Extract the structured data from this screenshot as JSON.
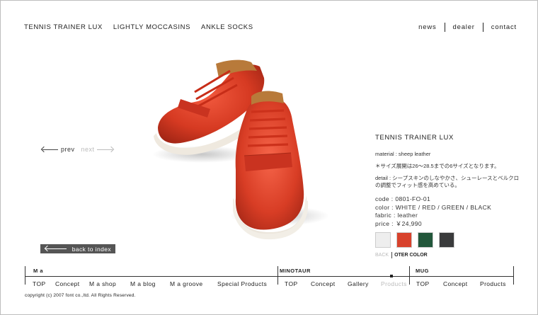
{
  "top_nav": {
    "items": [
      "TENNIS TRAINER LUX",
      "LIGHTLY MOCCASINS",
      "ANKLE SOCKS"
    ]
  },
  "right_nav": {
    "items": [
      "news",
      "dealer",
      "contact"
    ]
  },
  "pager": {
    "prev": "prev",
    "next": "next"
  },
  "back_to_index": "back to index",
  "product": {
    "title": "TENNIS TRAINER LUX",
    "material": "material : sheep leather",
    "size_note": "＊サイズ展開は26〜28.5までの6サイズとなります。",
    "detail": "detail : シープスキンのしなやかさ、シューレースとベルクロの調整でフィット感を高めている。",
    "code": "code : 0801-FO-01",
    "color": "color : WHITE / RED / GREEN / BLACK",
    "fabric": "fabric : leather",
    "price": "price : ￥24,990"
  },
  "swatches": [
    {
      "name": "white",
      "hex": "#eeeeee"
    },
    {
      "name": "red",
      "hex": "#d8422c"
    },
    {
      "name": "green",
      "hex": "#22573b"
    },
    {
      "name": "black",
      "hex": "#3a3b3c"
    }
  ],
  "color_links": {
    "back": "BACK",
    "other": "OTER COLOR"
  },
  "bottom_nav": {
    "sections": [
      {
        "heading": "M a",
        "links": [
          "TOP",
          "Concept",
          "M a shop",
          "M a blog",
          "M a groove",
          "Special Products"
        ]
      },
      {
        "heading": "MINOTAUR",
        "links": [
          "TOP",
          "Concept",
          "Gallery",
          "Products"
        ],
        "active": "Products"
      },
      {
        "heading": "MUG",
        "links": [
          "TOP",
          "Concept",
          "Products"
        ]
      }
    ]
  },
  "copyright": "copyright (c) 2007 font co.,ltd. All Rights Reserved.",
  "colors": {
    "accent_red": "#d8422c",
    "text": "#222222",
    "dim": "#bbbbbb"
  }
}
